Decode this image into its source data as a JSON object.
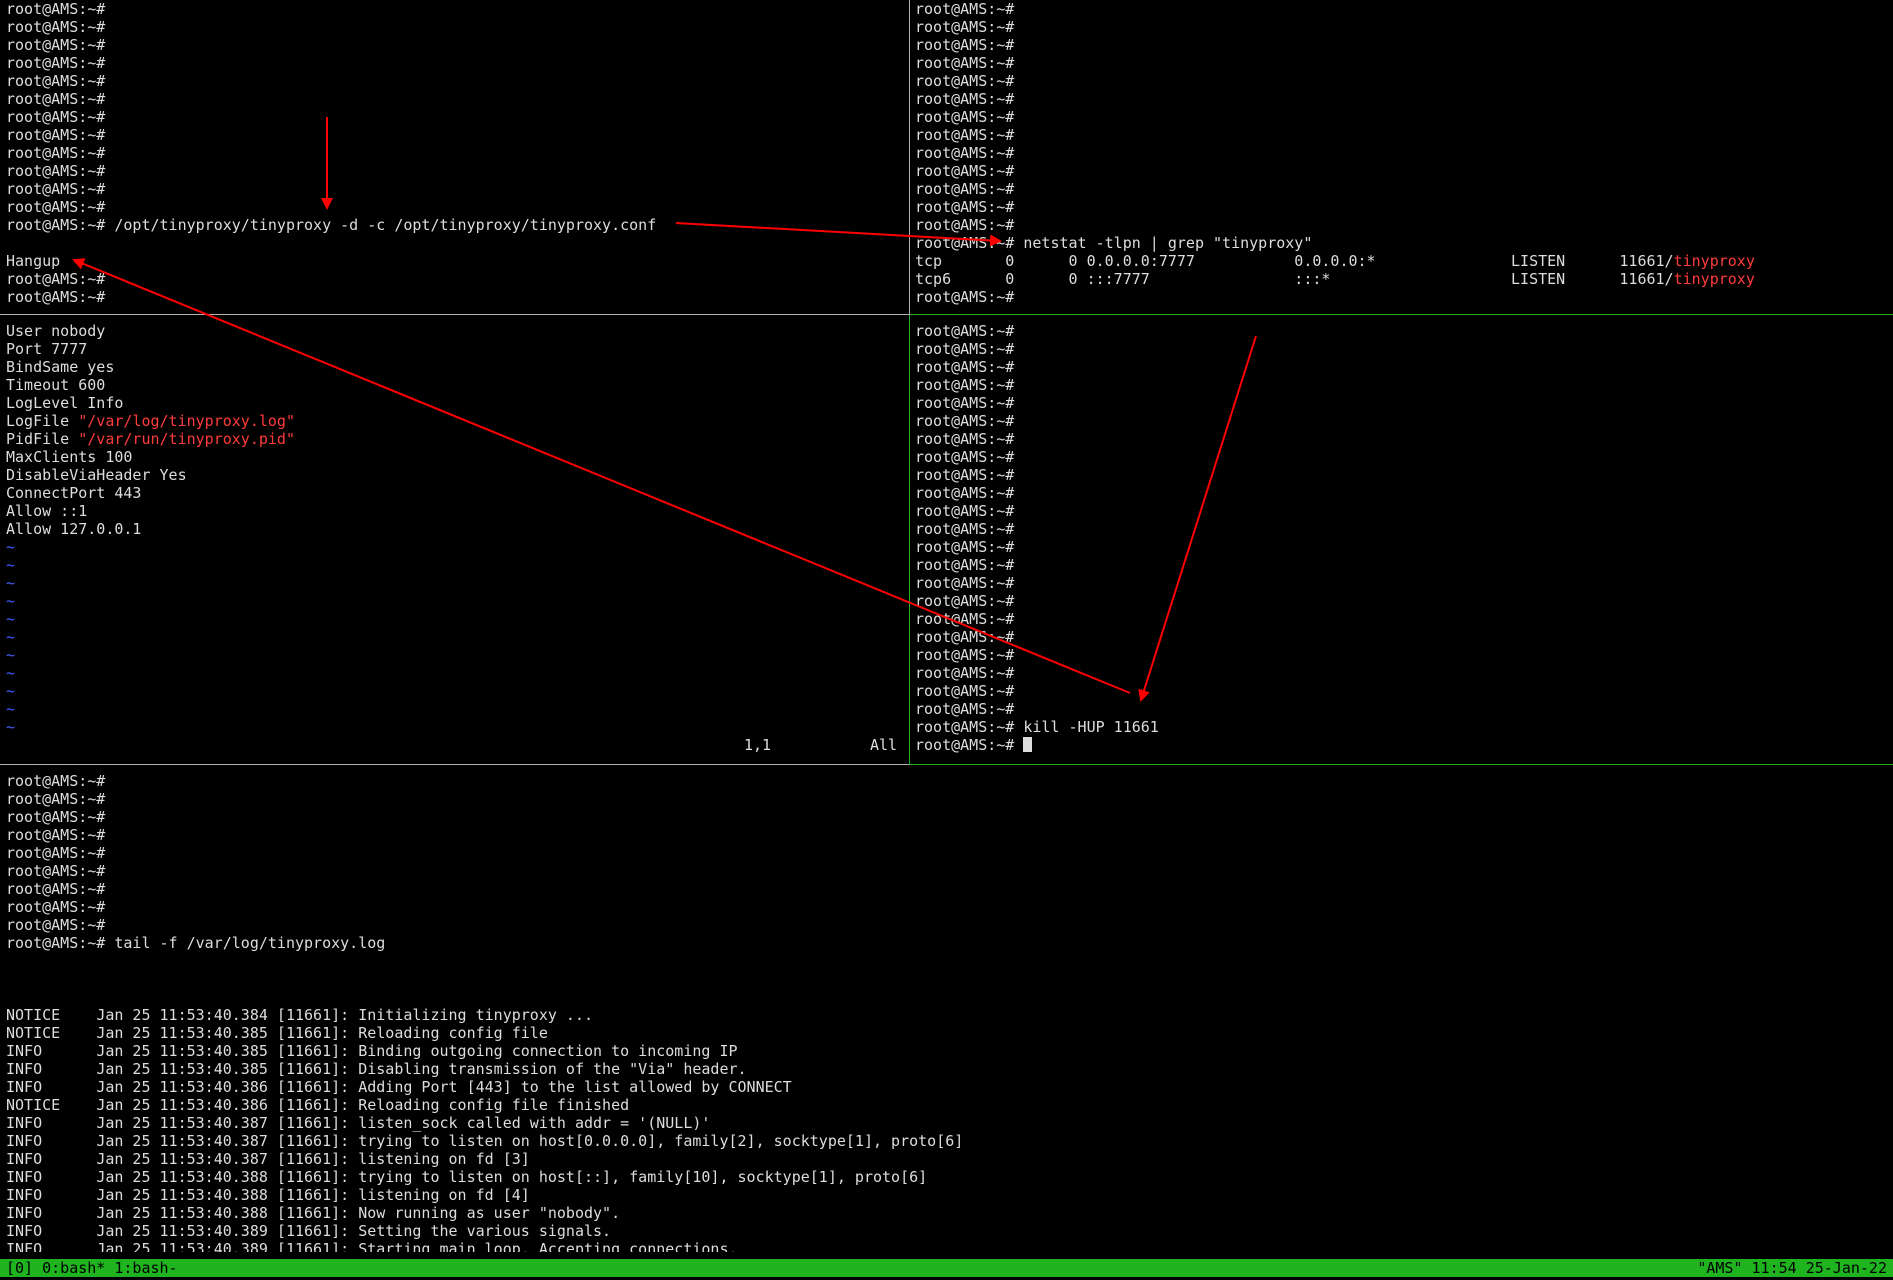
{
  "prompt": "root@AMS:~#",
  "pane_top_left": {
    "empty_prompts": 12,
    "command": "/opt/tinyproxy/tinyproxy -d -c /opt/tinyproxy/tinyproxy.conf",
    "output": "Hangup",
    "trailing_prompts": 2
  },
  "pane_top_right": {
    "empty_prompts": 13,
    "command": "netstat -tlpn | grep \"tinyproxy\"",
    "rows": [
      {
        "proto": "tcp",
        "recv": "0",
        "send": "0",
        "local": "0.0.0.0:7777",
        "foreign": "0.0.0.0:*",
        "state": "LISTEN",
        "pid": "11661/",
        "prog": "tinyproxy"
      },
      {
        "proto": "tcp6",
        "recv": "0",
        "send": "0",
        "local": ":::7777",
        "foreign": ":::*",
        "state": "LISTEN",
        "pid": "11661/",
        "prog": "tinyproxy"
      }
    ]
  },
  "pane_vim": {
    "lines": [
      {
        "text": "User nobody",
        "value": ""
      },
      {
        "text": "Port 7777",
        "value": ""
      },
      {
        "text": "BindSame yes",
        "value": ""
      },
      {
        "text": "Timeout 600",
        "value": ""
      },
      {
        "text": "LogLevel Info",
        "value": ""
      },
      {
        "text": "LogFile ",
        "value": "\"/var/log/tinyproxy.log\""
      },
      {
        "text": "PidFile ",
        "value": "\"/var/run/tinyproxy.pid\""
      },
      {
        "text": "MaxClients 100",
        "value": ""
      },
      {
        "text": "DisableViaHeader Yes",
        "value": ""
      },
      {
        "text": "ConnectPort 443",
        "value": ""
      },
      {
        "text": "Allow ::1",
        "value": ""
      },
      {
        "text": "Allow 127.0.0.1",
        "value": ""
      }
    ],
    "tilde_count": 11,
    "tilde": "~",
    "ruler_pos": "1,1",
    "ruler_scroll": "All"
  },
  "pane_mid_right": {
    "empty_prompts": 22,
    "command": "kill -HUP 11661"
  },
  "pane_bottom": {
    "empty_prompts": 9,
    "command": "tail -f /var/log/tinyproxy.log",
    "log": [
      {
        "level": "NOTICE",
        "ts": "Jan 25 11:53:40.384 [11661]:",
        "msg": "Initializing tinyproxy ..."
      },
      {
        "level": "NOTICE",
        "ts": "Jan 25 11:53:40.385 [11661]:",
        "msg": "Reloading config file"
      },
      {
        "level": "INFO",
        "ts": "Jan 25 11:53:40.385 [11661]:",
        "msg": "Binding outgoing connection to incoming IP"
      },
      {
        "level": "INFO",
        "ts": "Jan 25 11:53:40.385 [11661]:",
        "msg": "Disabling transmission of the \"Via\" header."
      },
      {
        "level": "INFO",
        "ts": "Jan 25 11:53:40.386 [11661]:",
        "msg": "Adding Port [443] to the list allowed by CONNECT"
      },
      {
        "level": "NOTICE",
        "ts": "Jan 25 11:53:40.386 [11661]:",
        "msg": "Reloading config file finished"
      },
      {
        "level": "INFO",
        "ts": "Jan 25 11:53:40.387 [11661]:",
        "msg": "listen_sock called with addr = '(NULL)'"
      },
      {
        "level": "INFO",
        "ts": "Jan 25 11:53:40.387 [11661]:",
        "msg": "trying to listen on host[0.0.0.0], family[2], socktype[1], proto[6]"
      },
      {
        "level": "INFO",
        "ts": "Jan 25 11:53:40.387 [11661]:",
        "msg": "listening on fd [3]"
      },
      {
        "level": "INFO",
        "ts": "Jan 25 11:53:40.388 [11661]:",
        "msg": "trying to listen on host[::], family[10], socktype[1], proto[6]"
      },
      {
        "level": "INFO",
        "ts": "Jan 25 11:53:40.388 [11661]:",
        "msg": "listening on fd [4]"
      },
      {
        "level": "INFO",
        "ts": "Jan 25 11:53:40.388 [11661]:",
        "msg": "Now running as user \"nobody\"."
      },
      {
        "level": "INFO",
        "ts": "Jan 25 11:53:40.389 [11661]:",
        "msg": "Setting the various signals."
      },
      {
        "level": "INFO",
        "ts": "Jan 25 11:53:40.389 [11661]:",
        "msg": "Starting main loop. Accepting connections."
      }
    ]
  },
  "statusbar": {
    "left": "[0] 0:bash* 1:bash-",
    "right": "\"AMS\" 11:54 25-Jan-22"
  },
  "colors": {
    "text": "#dddddd",
    "highlight": "#ff3b3b",
    "tilde": "#3f5bff",
    "active_border": "#1fb31f",
    "inactive_border": "#b0b0b0",
    "status_bg": "#1fb31f",
    "annotation_arrow": "#ff0000"
  }
}
